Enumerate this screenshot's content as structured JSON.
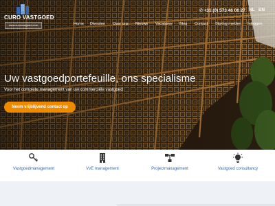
{
  "brand": {
    "name": "CURO VASTGOED",
    "tagline": "www.curovastgoed.com"
  },
  "topbar": {
    "phone": "+31 (0) 573 46 00 27",
    "languages": [
      "NL",
      "EN"
    ]
  },
  "nav": {
    "items": [
      "Home",
      "Diensten",
      "Over ons",
      "Nieuws",
      "Vacatures",
      "Blog",
      "Contact",
      "Storing melden",
      "Inloggen"
    ]
  },
  "hero": {
    "headline": "Uw vastgoedportefeuille, ons specialisme",
    "subline": "Voor het complete management van uw commerciële vastgoed",
    "cta_label": "Neem vrijblijvend contact op"
  },
  "services": [
    {
      "label": "Vastgoedmanagement",
      "icon": "key-icon"
    },
    {
      "label": "VvE management",
      "icon": "building-icon"
    },
    {
      "label": "Projectmanagement",
      "icon": "network-icon"
    },
    {
      "label": "Vastgoed consultancy",
      "icon": "lightbulb-icon"
    }
  ],
  "colors": {
    "accent": "#ee8a00",
    "service_text": "#3b67a8",
    "facade_frame": "#b8732a",
    "bottom_band": "#eef1f6"
  }
}
